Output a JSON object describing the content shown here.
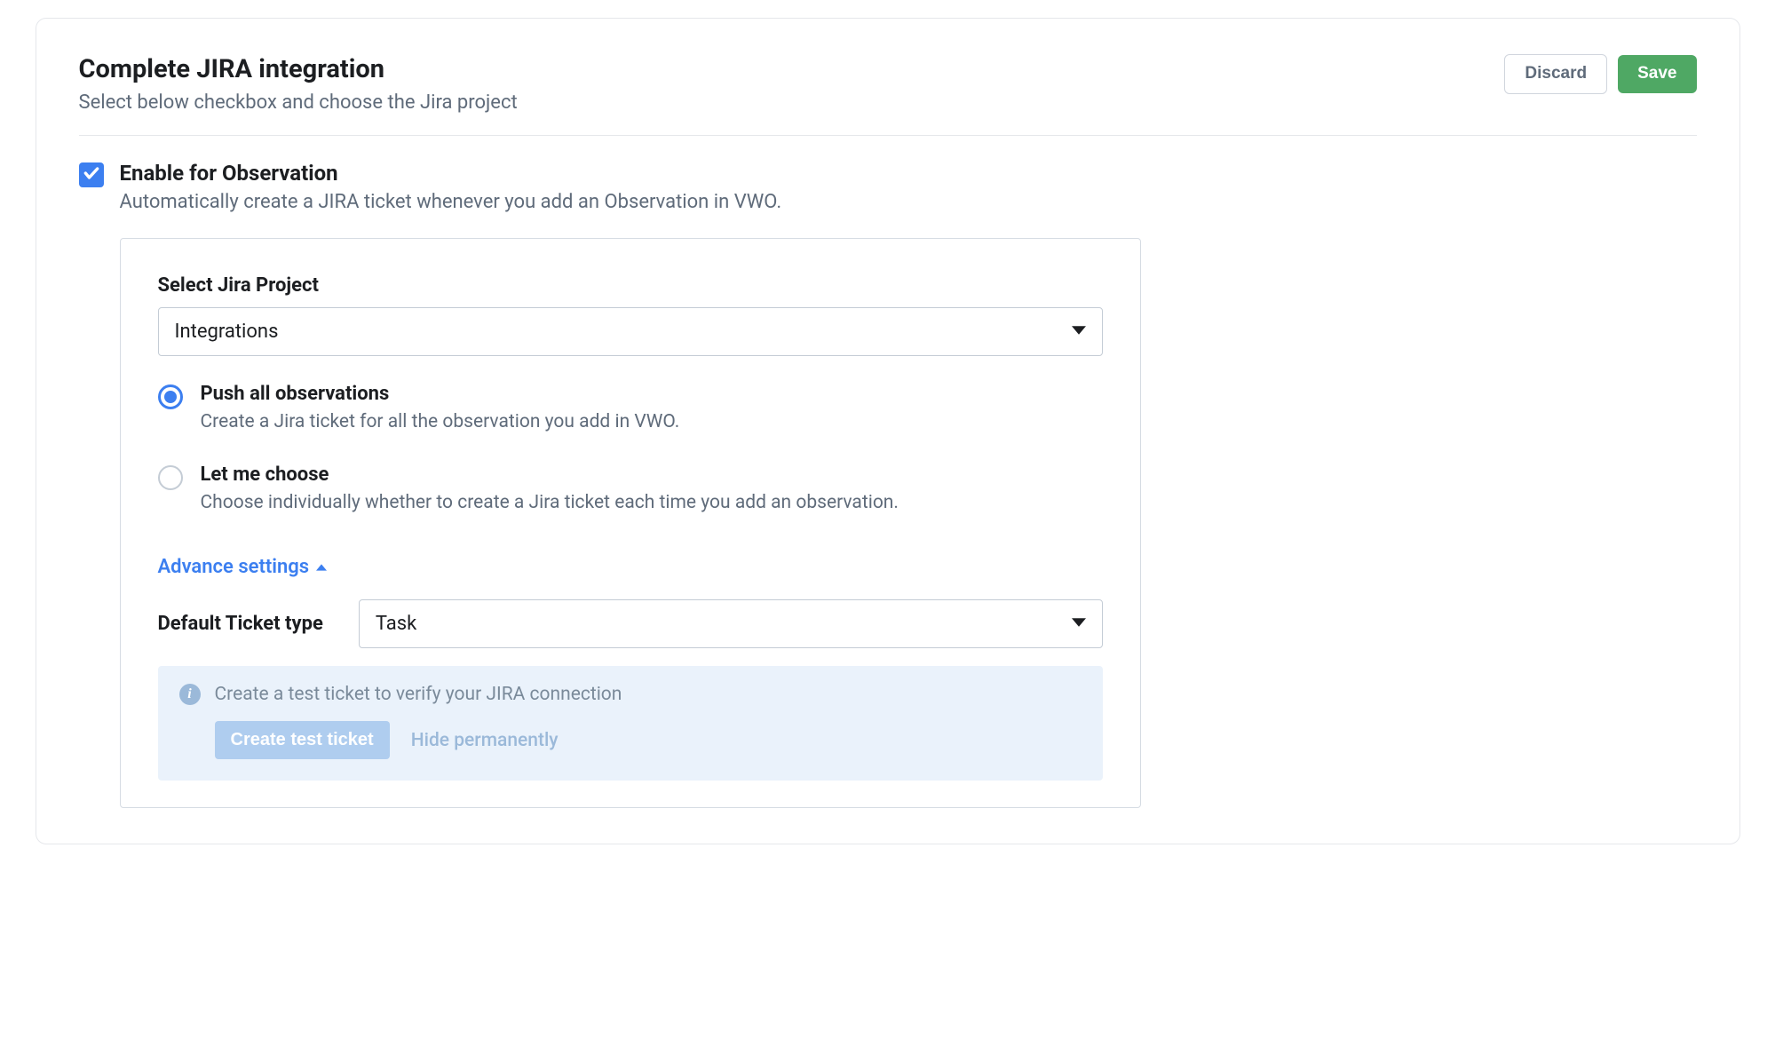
{
  "header": {
    "title": "Complete JIRA integration",
    "subtitle": "Select below checkbox and choose the Jira project",
    "discard_label": "Discard",
    "save_label": "Save"
  },
  "enable": {
    "title": "Enable for Observation",
    "description": "Automatically create a JIRA ticket whenever you add an Observation in VWO."
  },
  "project": {
    "label": "Select Jira Project",
    "selected": "Integrations"
  },
  "radios": {
    "push_all": {
      "title": "Push all observations",
      "description": "Create a Jira ticket for all the observation you add in VWO."
    },
    "let_me_choose": {
      "title": "Let me choose",
      "description": "Choose individually whether to create a Jira ticket each time you add an observation."
    }
  },
  "advance": {
    "label": "Advance settings"
  },
  "ticket_type": {
    "label": "Default Ticket type",
    "selected": "Task"
  },
  "info": {
    "text": "Create a test ticket to verify your JIRA connection",
    "create_label": "Create test ticket",
    "hide_label": "Hide permanently"
  }
}
